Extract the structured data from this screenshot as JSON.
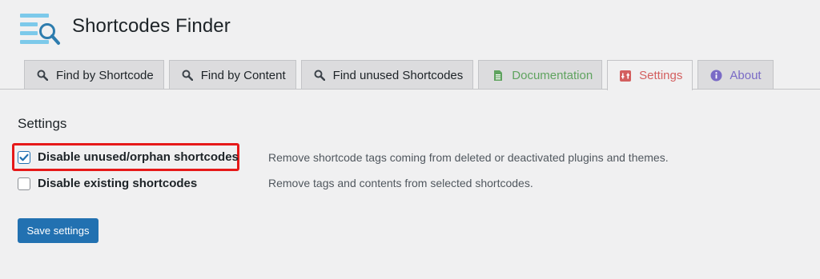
{
  "app": {
    "title": "Shortcodes Finder",
    "logo_icon": "search-list-logo-icon"
  },
  "tabs": [
    {
      "label": "Find by Shortcode",
      "icon": "search-icon",
      "color": "#1d2327"
    },
    {
      "label": "Find by Content",
      "icon": "search-icon",
      "color": "#1d2327"
    },
    {
      "label": "Find unused Shortcodes",
      "icon": "search-icon",
      "color": "#1d2327"
    },
    {
      "label": "Documentation",
      "icon": "document-icon",
      "color": "#5fa35f"
    },
    {
      "label": "Settings",
      "icon": "settings-icon",
      "color": "#d35f5f",
      "active": true
    },
    {
      "label": "About",
      "icon": "info-icon",
      "color": "#7a6bc6"
    }
  ],
  "settings": {
    "heading": "Settings",
    "options": [
      {
        "label": "Disable unused/orphan shortcodes",
        "checked": true,
        "description": "Remove shortcode tags coming from deleted or deactivated plugins and themes."
      },
      {
        "label": "Disable existing shortcodes",
        "checked": false,
        "description": "Remove tags and contents from selected shortcodes."
      }
    ],
    "save_label": "Save settings"
  },
  "colors": {
    "accent": "#2271b1",
    "highlight": "#e61919",
    "logo": "#7cc9ea"
  }
}
